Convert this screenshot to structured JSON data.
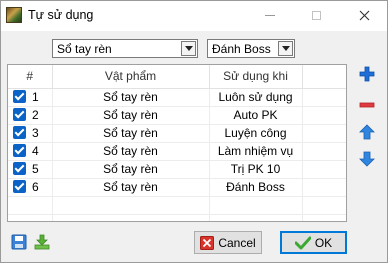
{
  "window": {
    "title": "Tự sử dụng"
  },
  "filters": {
    "item_selected": "Sổ tay rèn",
    "use_selected": "Đánh Boss"
  },
  "table": {
    "headers": [
      "#",
      "Vật phẩm",
      "Sử dụng khi"
    ],
    "rows": [
      {
        "index": "1",
        "item": "Sổ tay rèn",
        "when": "Luôn sử dụng",
        "checked": true
      },
      {
        "index": "2",
        "item": "Sổ tay rèn",
        "when": "Auto PK",
        "checked": true
      },
      {
        "index": "3",
        "item": "Sổ tay rèn",
        "when": "Luyện công",
        "checked": true
      },
      {
        "index": "4",
        "item": "Sổ tay rèn",
        "when": "Làm nhiệm vụ",
        "checked": true
      },
      {
        "index": "5",
        "item": "Sổ tay rèn",
        "when": "Trị PK 10",
        "checked": true
      },
      {
        "index": "6",
        "item": "Sổ tay rèn",
        "when": "Đánh Boss",
        "checked": true
      }
    ]
  },
  "side_icons": [
    "plus-icon",
    "minus-icon",
    "arrow-up-icon",
    "arrow-down-icon"
  ],
  "footer_icons": [
    "save-icon",
    "download-icon"
  ],
  "buttons": {
    "cancel_label": "Cancel",
    "ok_label": "OK"
  },
  "colors": {
    "accent": "#0b63c8",
    "add": "#1f6fd6",
    "remove": "#e0393e",
    "cancel_icon": "#d9342b",
    "ok_icon": "#3aa832"
  }
}
